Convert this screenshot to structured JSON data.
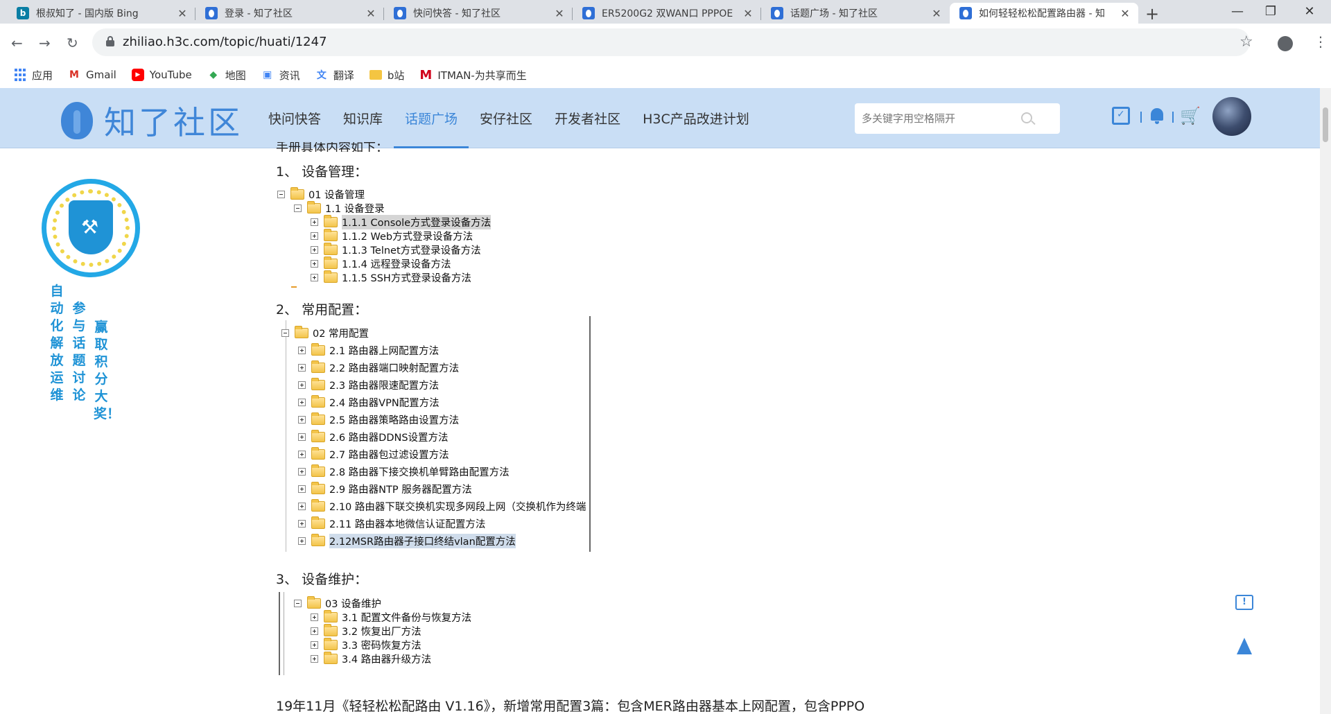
{
  "browser": {
    "tabs": [
      {
        "title": "根叔知了 - 国内版 Bing",
        "icon": "bing-icon"
      },
      {
        "title": "登录 - 知了社区",
        "icon": "zhiliao-icon"
      },
      {
        "title": "快问快答 - 知了社区",
        "icon": "zhiliao-icon"
      },
      {
        "title": "ER5200G2 双WAN口 PPPOE",
        "icon": "zhiliao-icon"
      },
      {
        "title": "话题广场 - 知了社区",
        "icon": "zhiliao-icon"
      },
      {
        "title": "如何轻轻松松配置路由器 - 知",
        "icon": "zhiliao-icon",
        "active": true
      }
    ],
    "url": "zhiliao.h3c.com/topic/huati/1247",
    "bookmarks": [
      "应用",
      "Gmail",
      "YouTube",
      "地图",
      "资讯",
      "翻译",
      "b站",
      "ITMAN-为共享而生"
    ]
  },
  "site": {
    "logo_text": "知了社区",
    "nav": [
      "快问快答",
      "知识库",
      "话题广场",
      "安仔社区",
      "开发者社区",
      "H3C产品改进计划"
    ],
    "active_nav": "话题广场",
    "search_placeholder": "多关键字用空格隔开",
    "accent": "#3b86d8",
    "header_bg": "#c9def5"
  },
  "sidebar": {
    "col1": "自动化解放运维",
    "col2": "参与话题讨论",
    "col3": "赢取积分大奖！"
  },
  "article": {
    "intro": "手册具体内容如下：",
    "sections": [
      {
        "heading": "1、  设备管理：",
        "root": "01 设备管理",
        "sub": "1.1 设备登录",
        "items": [
          "1.1.1 Console方式登录设备方法",
          "1.1.2 Web方式登录设备方法",
          "1.1.3 Telnet方式登录设备方法",
          "1.1.4 远程登录设备方法",
          "1.1.5 SSH方式登录设备方法"
        ]
      },
      {
        "heading": "2、  常用配置：",
        "root": "02 常用配置",
        "items": [
          "2.1 路由器上网配置方法",
          "2.2 路由器端口映射配置方法",
          "2.3 路由器限速配置方法",
          "2.4 路由器VPN配置方法",
          "2.5 路由器策略路由设置方法",
          "2.6 路由器DDNS设置方法",
          "2.7 路由器包过滤设置方法",
          "2.8 路由器下接交换机单臂路由配置方法",
          "2.9 路由器NTP 服务器配置方法",
          "2.10 路由器下联交换机实现多网段上网（交换机作为终端",
          "2.11 路由器本地微信认证配置方法",
          "2.12MSR路由器子接口终结vlan配置方法"
        ]
      },
      {
        "heading": "3、  设备维护：",
        "root": "03 设备维护",
        "items": [
          "3.1 配置文件备份与恢复方法",
          "3.2 恢复出厂方法",
          "3.3 密码恢复方法",
          "3.4 路由器升级方法"
        ]
      }
    ],
    "footer": "19年11月《轻轻松松配路由 V1.16》，新增常用配置3篇：包含MER路由器基本上网配置，包含PPPO"
  }
}
